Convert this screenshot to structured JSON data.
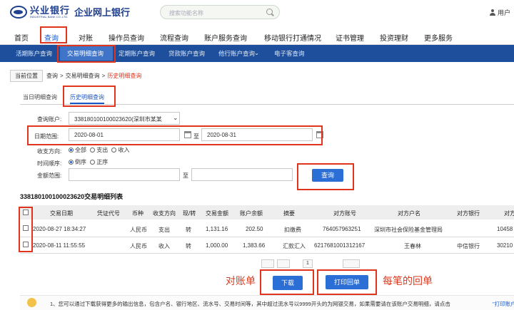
{
  "header": {
    "bank_name": "兴业银行",
    "bank_name_en": "INDUSTRIAL BANK CO.,LTD.",
    "site_name": "企业网上银行",
    "search_placeholder": "搜索功能名称",
    "user_label": "用户"
  },
  "main_nav": [
    "首页",
    "查询",
    "对账",
    "操作员查询",
    "流程查询",
    "账户服务查询",
    "移动银行打通情况",
    "证书管理",
    "投资理财",
    "更多服务"
  ],
  "sub_nav": [
    "活期账户查询",
    "交易明细查询",
    "定期账户查询",
    "贷款账户查询",
    "他行账户查询",
    "电子客查询"
  ],
  "breadcrumb": {
    "position_label": "当前位置",
    "items": [
      "查询",
      "交易明细查询"
    ],
    "current": "历史明细查询",
    "separator": ">"
  },
  "tabs": [
    "当日明细查询",
    "历史明细查询"
  ],
  "form": {
    "account_label": "查询账户:",
    "account_value": "338180100100023620(深圳市某某",
    "date_label": "日期范围:",
    "date_from": "2020-08-01",
    "date_to": "2020-08-31",
    "date_sep": "至",
    "direction_label": "收支方向:",
    "direction_options": [
      "全部",
      "支出",
      "收入"
    ],
    "order_label": "时间顺序:",
    "order_options": [
      "倒序",
      "正序"
    ],
    "amount_label": "金额范围:",
    "amount_sep": "至",
    "query_button": "查询"
  },
  "list": {
    "title": "338180100100023620交易明细列表",
    "columns": [
      "交易日期",
      "凭证代号",
      "币种",
      "收支方向",
      "现/转",
      "交易金额",
      "账户余额",
      "摘要",
      "对方账号",
      "对方户名",
      "对方银行",
      "对方"
    ],
    "rows": [
      {
        "date": "2020-08-27 18:34:27",
        "voucher": "",
        "currency": "人民币",
        "direction": "支出",
        "cash_transfer": "转",
        "amount": "1,131.16",
        "balance": "202.50",
        "summary": "扣缴费",
        "counter_account": "764057963251",
        "counter_name": "深圳市社会保险基金管理局",
        "counter_bank": "",
        "extra": "10458"
      },
      {
        "date": "2020-08-11 11:55:55",
        "voucher": "",
        "currency": "人民币",
        "direction": "收入",
        "cash_transfer": "转",
        "amount": "1,000.00",
        "balance": "1,383.66",
        "summary": "汇款汇入",
        "counter_account": "6217681001312167",
        "counter_name": "王春林",
        "counter_bank": "中信银行",
        "extra": "30210"
      }
    ]
  },
  "pager": {
    "current": "1"
  },
  "actions": {
    "download": "下载",
    "print_receipt": "打印回单"
  },
  "annotations": {
    "statement": "对账单",
    "per_receipt": "每笔的回单"
  },
  "notice": {
    "text": "1、您可以通过下载获得更多的输出信息，包含户名、银行地区、流水号、交易时间等，其中超过流水号以9999开头的为网银交易，如果需要请在该账户交易明细，请点击",
    "link": "\"打印账户报"
  },
  "colors": {
    "brand_blue": "#1f3f8f",
    "subnav_bg": "#1e4f9c",
    "button_blue": "#2b6fd6",
    "highlight_red": "#e0351c"
  }
}
